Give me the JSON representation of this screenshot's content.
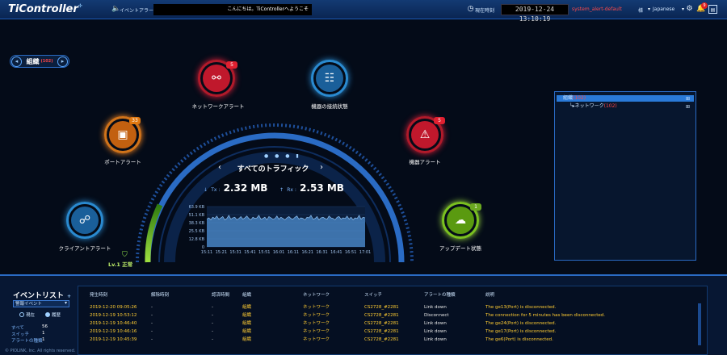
{
  "header": {
    "logo": "TiController",
    "event_alarm_label": "イベントアラーム",
    "ticker": "こんにちは。TiControllerへようこそ",
    "current_time_label": "現在時刻",
    "clock": "2019-12-24 13:10:19",
    "system_alert": "system_alert-default",
    "user": "様",
    "language": "Japanese",
    "notification_count": "9"
  },
  "org": {
    "label": "組織",
    "count": "(102)"
  },
  "nodes": {
    "network_alert": {
      "label": "ネットワークアラート",
      "badge": "5"
    },
    "connection_status": {
      "label": "機器の接続状態"
    },
    "port_alert": {
      "label": "ポートアラート",
      "badge": "33"
    },
    "device_alert": {
      "label": "機器アラート",
      "badge": "5"
    },
    "client_alert": {
      "label": "クライアントアラート"
    },
    "update_status": {
      "label": "アップデート状態",
      "badge": "1"
    }
  },
  "traffic": {
    "title": "すべてのトラフィック",
    "tx_label": "Tx :",
    "tx_value": "2.32 MB",
    "rx_label": "Rx :",
    "rx_value": "2.53 MB"
  },
  "chart_data": {
    "type": "area",
    "title": "",
    "xlabel": "",
    "ylabel": "",
    "y_ticks": [
      "63.9 KB",
      "51.1 KB",
      "38.3 KB",
      "25.5 KB",
      "12.8 KB",
      "0"
    ],
    "x_ticks": [
      "15:11",
      "15:21",
      "15:31",
      "15:41",
      "15:51",
      "16:01",
      "16:11",
      "16:21",
      "16:31",
      "16:41",
      "16:51",
      "17:01"
    ],
    "ylim": [
      0,
      63.9
    ],
    "values": [
      44,
      46,
      43,
      47,
      45,
      49,
      44,
      46,
      48,
      43,
      45,
      50,
      44,
      46,
      47,
      43,
      45,
      48,
      44,
      46,
      49,
      45,
      43,
      47,
      45,
      46,
      50,
      44,
      45,
      47,
      43,
      48,
      46,
      44,
      45,
      49,
      44,
      47,
      45,
      43,
      46,
      48,
      45,
      44,
      47,
      49,
      44,
      46,
      45,
      43,
      47,
      46,
      50,
      44,
      45,
      48,
      43,
      46,
      47,
      45,
      44,
      49,
      46,
      45,
      43,
      47,
      48,
      44,
      46,
      45,
      49,
      44,
      47,
      43,
      46,
      45,
      50,
      44,
      47,
      46
    ],
    "color": "#4f8fd0"
  },
  "level": {
    "label": "Lv.1 正常"
  },
  "tree": {
    "root": {
      "label": "組織",
      "count": "(102)"
    },
    "child": {
      "label": "ネットワーク",
      "count": "(102)"
    }
  },
  "events": {
    "title": "イベントリスト",
    "filter": "警報イベント",
    "radio_current": "現在",
    "radio_history": "履歴",
    "stats": [
      {
        "label": "すべて",
        "value": "56"
      },
      {
        "label": "スイッチ",
        "value": "1"
      },
      {
        "label": "アラートの種類",
        "value": "1"
      }
    ],
    "columns": [
      "発生時刻",
      "解除時刻",
      "認済時間",
      "組織",
      "ネットワーク",
      "スイッチ",
      "アラートの種類",
      "説明"
    ],
    "rows": [
      [
        "2019-12-20 09:05:26",
        "-",
        "-",
        "組織",
        "ネットワーク",
        "CS2728_#2281",
        "Link down",
        "The ge13(Port) is disconnected."
      ],
      [
        "2019-12-19 10:53:12",
        "-",
        "-",
        "組織",
        "ネットワーク",
        "CS2728_#2281",
        "Disconnect",
        "The connection for 5 minutes has been disconnected."
      ],
      [
        "2019-12-19 10:46:40",
        "-",
        "-",
        "組織",
        "ネットワーク",
        "CS2728_#2281",
        "Link down",
        "The ge24(Port) is disconnected."
      ],
      [
        "2019-12-19 10:46:16",
        "-",
        "-",
        "組織",
        "ネットワーク",
        "CS2728_#2281",
        "Link down",
        "The ge17(Port) is disconnected."
      ],
      [
        "2019-12-19 10:45:39",
        "-",
        "-",
        "組織",
        "ネットワーク",
        "CS2728_#2281",
        "Link down",
        "The ge6(Port) is disconnected."
      ]
    ]
  },
  "footer": "© PIOLINK, Inc. All rights reserved."
}
